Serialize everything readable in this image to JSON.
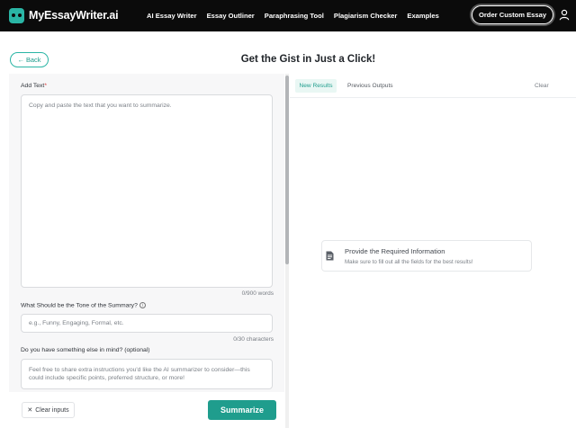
{
  "header": {
    "logo_text": "MyEssayWriter.ai",
    "nav": [
      "AI Essay Writer",
      "Essay Outliner",
      "Paraphrasing Tool",
      "Plagiarism Checker",
      "Examples"
    ],
    "order_button": "Order Custom Essay",
    "user_icon": "user-icon"
  },
  "page": {
    "back_label": "← Back",
    "title": "Get the Gist in Just a Click!"
  },
  "form": {
    "text_label": "Add Text",
    "text_required_mark": "*",
    "text_placeholder": "Copy and paste the text that you want to summarize.",
    "text_counter": "0/900 words",
    "tone_label": "What Should be the Tone of the Summary?",
    "tone_info_icon": "i",
    "tone_placeholder": "e.g., Funny, Engaging, Formal, etc.",
    "tone_counter": "0/30 characters",
    "extra_label": "Do you have something else in mind? (optional)",
    "extra_placeholder": "Feel free to share extra instructions you'd like the AI summarizer to consider—this could include specific points, preferred structure, or more!",
    "clear_inputs_label": "Clear inputs",
    "clear_inputs_icon": "✕",
    "summarize_label": "Summarize"
  },
  "results": {
    "tabs": [
      "New Results",
      "Previous Outputs"
    ],
    "active_tab": "New Results",
    "clear_label": "Clear",
    "empty_title": "Provide the Required Information",
    "empty_subtitle": "Make sure to fill out all the fields for the best results!",
    "empty_icon": "document-icon"
  },
  "colors": {
    "accent": "#1f9d8d",
    "topbar": "#0b0b0b"
  }
}
